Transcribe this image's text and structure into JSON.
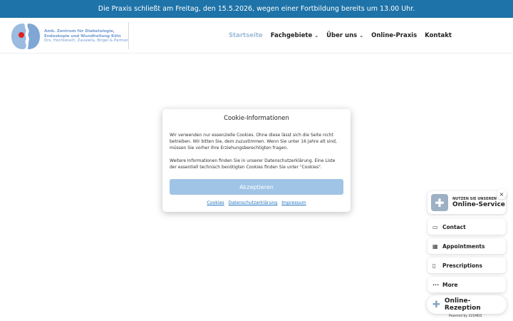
{
  "banner": {
    "text": "Die Praxis schließt am Freitag, den 15.5.2026, wegen einer Fortbildung bereits um 13.00 Uhr."
  },
  "logo": {
    "line1": "Amb. Zentrum für Diabetologie,",
    "line2": "Endoskopie und Wundheilung Köln",
    "line3": "Drs. Hochlenert, Zavaleta, Birgel & Partner"
  },
  "nav": {
    "items": [
      {
        "label": "Startseite",
        "active": true
      },
      {
        "label": "Fachgebiete",
        "dropdown": true
      },
      {
        "label": "Über uns",
        "dropdown": true
      },
      {
        "label": "Online-Praxis"
      },
      {
        "label": "Kontakt"
      }
    ],
    "chevron": "⌄"
  },
  "cookie": {
    "title": "Cookie-Informationen",
    "paragraph1": "Wir verwenden nur essenzielle Cookies. Ohne diese lässt sich die Seite nicht betreiben. Wir bitten Sie, dem zuzustimmen. Wenn Sie unter 16 Jahre alt sind, müssen Sie vorher Ihre Erziehungsberechtigten fragen.",
    "paragraph2": "Weitere Informationen finden Sie in unserer Datenschutzerklärung. Eine Liste der essentiell technisch benötigten Cookies finden Sie unter \"Cookies\".",
    "accept_label": "Akzeptieren",
    "links": [
      "Cookies",
      "Datenschutzerklärung",
      "Impressum"
    ]
  },
  "widget": {
    "service_small": "NUTZEN SIE UNSEREN",
    "service_big": "Online-Service",
    "close": "×",
    "actions": [
      {
        "label": "Contact",
        "icon": "chat-icon",
        "glyph": "▭"
      },
      {
        "label": "Appointments",
        "icon": "calendar-icon",
        "glyph": "▦"
      },
      {
        "label": "Prescriptions",
        "icon": "document-icon",
        "glyph": "▯"
      },
      {
        "label": "More",
        "icon": "more-icon",
        "glyph": "···"
      }
    ],
    "rezeption_label": "Online-Rezeption",
    "powered_by": "Powered by 321MED"
  },
  "colors": {
    "banner": "#1e73a8",
    "accent": "#6f98cf",
    "button": "#9fc4e6"
  }
}
